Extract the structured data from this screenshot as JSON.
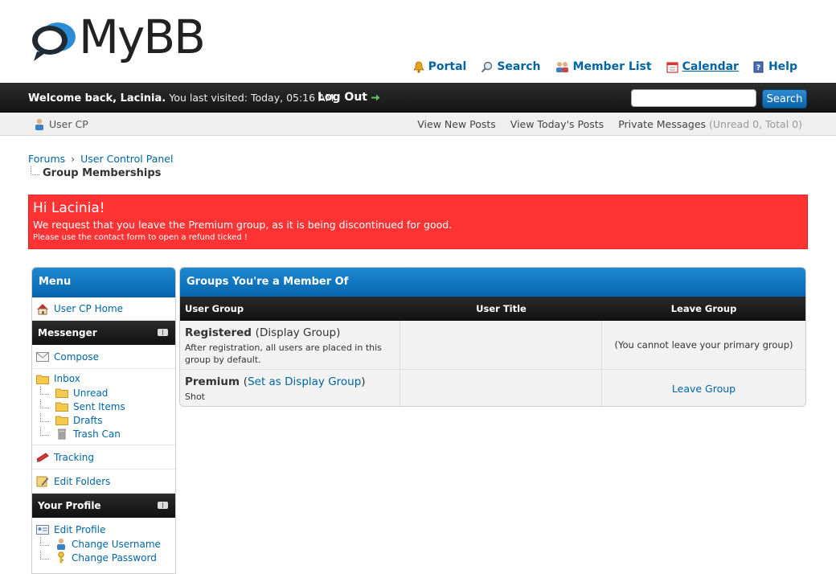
{
  "brand": {
    "logo_text": "MyBB"
  },
  "top_links": [
    {
      "label": "Portal",
      "icon": "bell-icon"
    },
    {
      "label": "Search",
      "icon": "magnifier-icon"
    },
    {
      "label": "Member List",
      "icon": "members-icon"
    },
    {
      "label": "Calendar",
      "icon": "calendar-icon"
    },
    {
      "label": "Help",
      "icon": "help-icon"
    }
  ],
  "topbar": {
    "welcome_prefix": "Welcome back, Lacinia.",
    "last_visit": "You last visited: Today, 05:16 AM",
    "logout_label": "Log Out",
    "search_placeholder": "",
    "search_button": "Search"
  },
  "subbar": {
    "user_cp": "User CP",
    "view_new_posts": "View New Posts",
    "view_todays_posts": "View Today's Posts",
    "private_messages": "Private Messages",
    "pm_counts": "(Unread 0, Total 0)"
  },
  "breadcrumb": {
    "items": [
      "Forums",
      "User Control Panel"
    ],
    "separator": "›",
    "current": "Group Memberships"
  },
  "alert": {
    "heading": "Hi Lacinia!",
    "line1": "We request that you leave the Premium group, as it is being discontinued for good.",
    "line2": "Please use the contact form to open a refund ticked !",
    "color": "#ff3333"
  },
  "menu": {
    "title": "Menu",
    "home": "User CP Home",
    "messenger": {
      "title": "Messenger",
      "compose": "Compose",
      "inbox": "Inbox",
      "folders": [
        "Unread",
        "Sent Items",
        "Drafts",
        "Trash Can"
      ],
      "tracking": "Tracking",
      "edit_folders": "Edit Folders"
    },
    "profile": {
      "title": "Your Profile",
      "edit_profile": "Edit Profile",
      "sub": [
        "Change Username",
        "Change Password"
      ]
    }
  },
  "groups": {
    "title": "Groups You're a Member Of",
    "columns": [
      "User Group",
      "User Title",
      "Leave Group"
    ],
    "rows": [
      {
        "name": "Registered",
        "display_note": "(Display Group)",
        "description": "After registration, all users are placed in this group by default.",
        "title": "",
        "leave": "(You cannot leave your primary group)"
      },
      {
        "name": "Premium",
        "set_display_open": "(",
        "set_display_link": "Set as Display Group",
        "set_display_close": ")",
        "description": "Shot",
        "title": "",
        "leave": "Leave Group"
      }
    ]
  },
  "colors": {
    "accent": "#0666b0",
    "link": "#0066a2",
    "dark_bar": "#151515"
  }
}
